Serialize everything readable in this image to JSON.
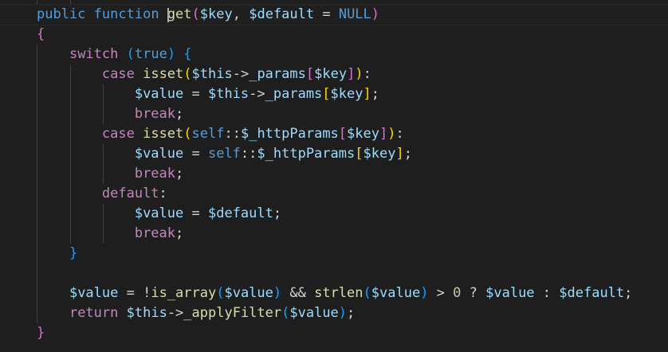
{
  "editor": {
    "language": "php",
    "theme_colors": {
      "background": "#1e1e1e",
      "keyword": "#569cd6",
      "control": "#c586c0",
      "function": "#dcdcaa",
      "variable": "#9cdcfe",
      "number": "#b5cea8",
      "bracket_level1": "#da70d6",
      "bracket_level2": "#179fff",
      "bracket_level3": "#ffd700"
    },
    "lines": [
      {
        "text": "public function get($key, $default = NULL)"
      },
      {
        "text": "{"
      },
      {
        "text": "    switch (true) {"
      },
      {
        "text": "        case isset($this->_params[$key]):"
      },
      {
        "text": "            $value = $this->_params[$key];"
      },
      {
        "text": "            break;"
      },
      {
        "text": "        case isset(self::$_httpParams[$key]):"
      },
      {
        "text": "            $value = self::$_httpParams[$key];"
      },
      {
        "text": "            break;"
      },
      {
        "text": "        default:"
      },
      {
        "text": "            $value = $default;"
      },
      {
        "text": "            break;"
      },
      {
        "text": "    }"
      },
      {
        "text": ""
      },
      {
        "text": "    $value = !is_array($value) && strlen($value) > 0 ? $value : $default;"
      },
      {
        "text": "    return $this->_applyFilter($value);"
      },
      {
        "text": "}"
      }
    ],
    "tokens": {
      "l0": {
        "public": "public",
        "function": "function",
        "name": "get",
        "open": "(",
        "key": "$key",
        "comma": ", ",
        "def": "$default",
        "eq": " = ",
        "null": "NULL",
        "close": ")"
      },
      "l1": {
        "brace": "{"
      },
      "l2": {
        "switch": "switch",
        "open": " (",
        "true": "true",
        "close": ")",
        "brace": " {"
      },
      "l3": {
        "case": "case",
        "isset": "isset",
        "open": "(",
        "this": "$this",
        "arrow": "->",
        "prop": "_params",
        "lb": "[",
        "key": "$key",
        "rb": "]",
        "close": ")",
        "colon": ":"
      },
      "l4": {
        "value": "$value",
        "eq": " = ",
        "this": "$this",
        "arrow": "->",
        "prop": "_params",
        "lb": "[",
        "key": "$key",
        "rb": "]",
        "semi": ";"
      },
      "l5": {
        "brk": "break",
        "semi": ";"
      },
      "l6": {
        "case": "case",
        "isset": "isset",
        "open": "(",
        "self": "self",
        "dc": "::",
        "prop": "$_httpParams",
        "lb": "[",
        "key": "$key",
        "rb": "]",
        "close": ")",
        "colon": ":"
      },
      "l7": {
        "value": "$value",
        "eq": " = ",
        "self": "self",
        "dc": "::",
        "prop": "$_httpParams",
        "lb": "[",
        "key": "$key",
        "rb": "]",
        "semi": ";"
      },
      "l8": {
        "brk": "break",
        "semi": ";"
      },
      "l9": {
        "default": "default",
        "colon": ":"
      },
      "l10": {
        "value": "$value",
        "eq": " = ",
        "def": "$default",
        "semi": ";"
      },
      "l11": {
        "brk": "break",
        "semi": ";"
      },
      "l12": {
        "brace": "}"
      },
      "l14": {
        "value": "$value",
        "eq": " = !",
        "isarr": "is_array",
        "open": "(",
        "arg": "$value",
        "close": ")",
        "and": " && ",
        "strlen": "strlen",
        "open2": "(",
        "arg2": "$value",
        "close2": ")",
        "gt": " > ",
        "zero": "0",
        "q": " ? ",
        "v3": "$value",
        "c": " : ",
        "def": "$default",
        "semi": ";"
      },
      "l15": {
        "ret": "return",
        "sp": " ",
        "this": "$this",
        "arrow": "->",
        "fn": "_applyFilter",
        "open": "(",
        "arg": "$value",
        "close": ")",
        "semi": ";"
      },
      "l16": {
        "brace": "}"
      }
    }
  }
}
